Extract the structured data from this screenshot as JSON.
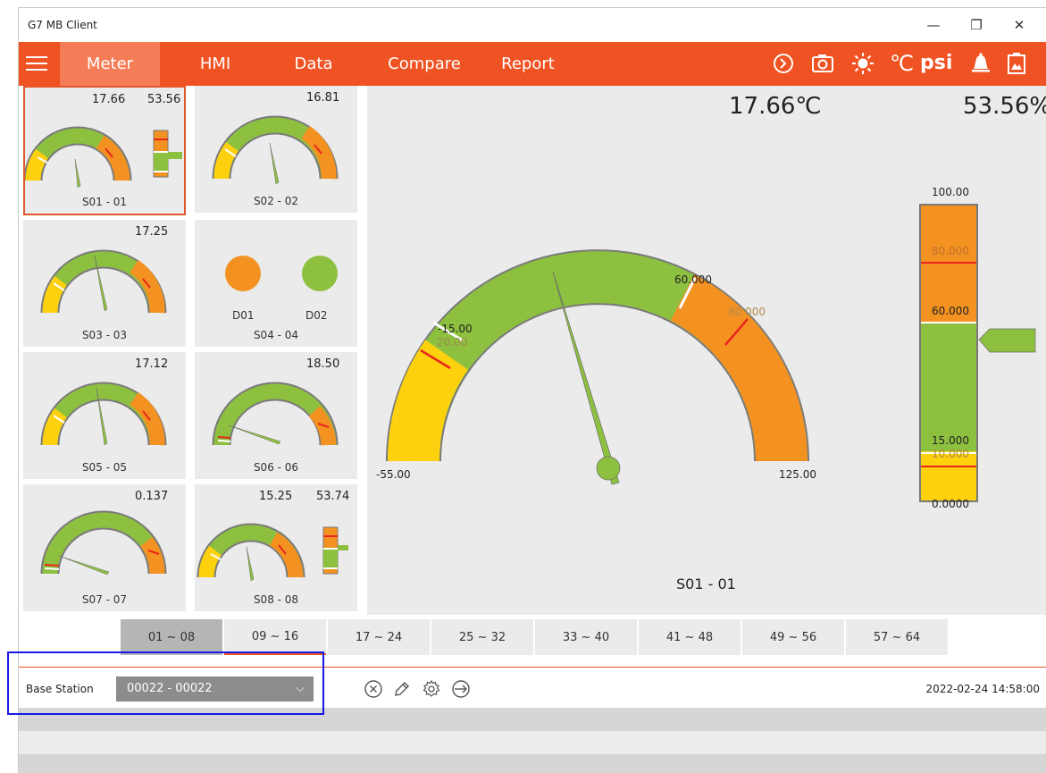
{
  "window": {
    "title": "G7 MB Client",
    "minimize": "—",
    "restore": "❐",
    "close": "✕"
  },
  "menu": {
    "tabs": [
      {
        "label": "Meter"
      },
      {
        "label": "HMI"
      },
      {
        "label": "Data"
      },
      {
        "label": "Compare"
      },
      {
        "label": "Report"
      }
    ],
    "unit_celsius": "℃",
    "unit_psi": "psi"
  },
  "tiles": [
    {
      "label": "S01 - 01",
      "v1": "17.66",
      "v2": "53.56"
    },
    {
      "label": "S02 - 02",
      "v1": "16.81"
    },
    {
      "label": "S03 - 03",
      "v1": "17.25"
    },
    {
      "label": "S04 - 04",
      "d1": "D01",
      "d2": "D02"
    },
    {
      "label": "S05 - 05",
      "v1": "17.12"
    },
    {
      "label": "S06 - 06",
      "v1": "18.50"
    },
    {
      "label": "S07 - 07",
      "v1": "0.137"
    },
    {
      "label": "S08 - 08",
      "v1": "15.25",
      "v2": "53.74"
    }
  ],
  "main": {
    "temp": "17.66℃",
    "humidity": "53.56%",
    "sensor": "S01 - 01",
    "gauge": {
      "min": "-55.00",
      "max": "125.00",
      "low_alarm": "-15.00",
      "low_warn": "20.00",
      "high_warn": "60.000",
      "high_alarm": "80.000",
      "value": 17.66
    },
    "bar": {
      "max": "100.00",
      "high_alarm": "80.000",
      "high_warn": "60.000",
      "low_warn": "15.000",
      "low_alarm": "10.000",
      "min": "0.0000",
      "value": 53.56
    }
  },
  "pages": [
    "01 ~ 08",
    "09 ~ 16",
    "17 ~ 24",
    "25 ~ 32",
    "33 ~ 40",
    "41 ~ 48",
    "49 ~ 56",
    "57 ~ 64"
  ],
  "toolbar": {
    "base_station_label": "Base Station",
    "base_station_value": "00022 - 00022",
    "datetime": "2022-02-24 14:58:00"
  },
  "colors": {
    "accent": "#f05323",
    "green": "#8dc03f",
    "orange": "#f39221",
    "yellow": "#fdd10d",
    "alarm": "#e8261e"
  }
}
